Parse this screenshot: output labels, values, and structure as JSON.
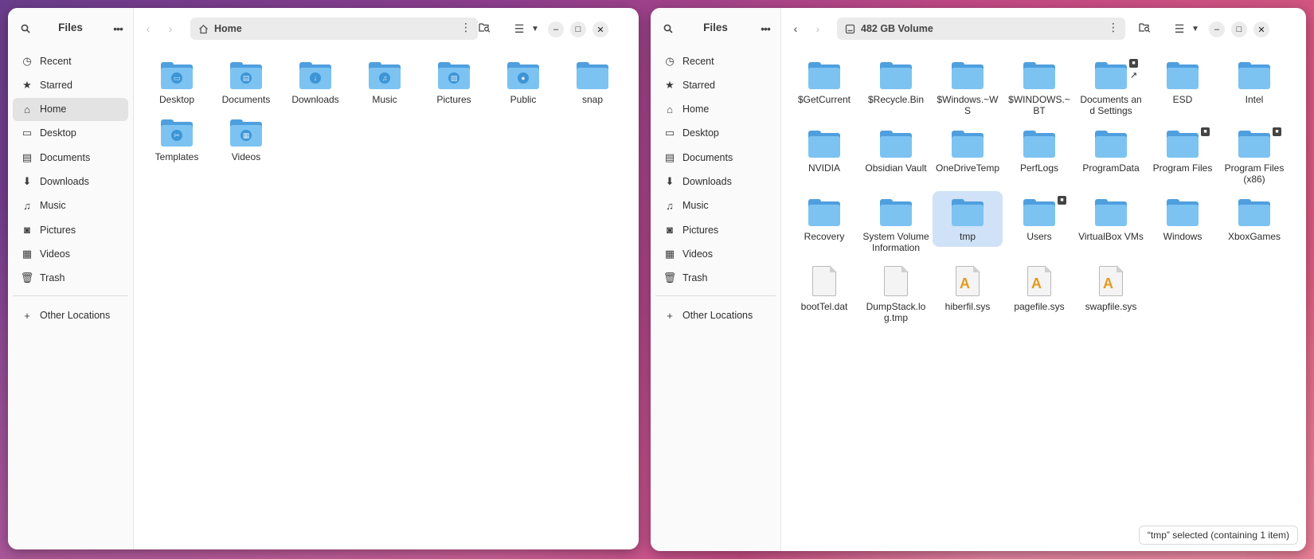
{
  "left_window": {
    "sidebar": {
      "title": "Files",
      "items": [
        {
          "label": "Recent",
          "icon": "clock-icon",
          "active": false
        },
        {
          "label": "Starred",
          "icon": "star-icon",
          "active": false
        },
        {
          "label": "Home",
          "icon": "home-icon",
          "active": true
        },
        {
          "label": "Desktop",
          "icon": "desktop-icon",
          "active": false
        },
        {
          "label": "Documents",
          "icon": "document-icon",
          "active": false
        },
        {
          "label": "Downloads",
          "icon": "download-icon",
          "active": false
        },
        {
          "label": "Music",
          "icon": "music-icon",
          "active": false
        },
        {
          "label": "Pictures",
          "icon": "camera-icon",
          "active": false
        },
        {
          "label": "Videos",
          "icon": "film-icon",
          "active": false
        },
        {
          "label": "Trash",
          "icon": "trash-icon",
          "active": false
        }
      ],
      "other_locations": "Other Locations"
    },
    "path": "Home",
    "items": [
      {
        "label": "Desktop",
        "kind": "folder",
        "emblem": "desktop"
      },
      {
        "label": "Documents",
        "kind": "folder",
        "emblem": "document"
      },
      {
        "label": "Downloads",
        "kind": "folder",
        "emblem": "download"
      },
      {
        "label": "Music",
        "kind": "folder",
        "emblem": "music"
      },
      {
        "label": "Pictures",
        "kind": "folder",
        "emblem": "picture"
      },
      {
        "label": "Public",
        "kind": "folder",
        "emblem": "user"
      },
      {
        "label": "snap",
        "kind": "folder",
        "emblem": ""
      },
      {
        "label": "Templates",
        "kind": "folder",
        "emblem": "template"
      },
      {
        "label": "Videos",
        "kind": "folder",
        "emblem": "video"
      }
    ]
  },
  "right_window": {
    "sidebar": {
      "title": "Files",
      "items": [
        {
          "label": "Recent",
          "icon": "clock-icon",
          "active": false
        },
        {
          "label": "Starred",
          "icon": "star-icon",
          "active": false
        },
        {
          "label": "Home",
          "icon": "home-icon",
          "active": false
        },
        {
          "label": "Desktop",
          "icon": "desktop-icon",
          "active": false
        },
        {
          "label": "Documents",
          "icon": "document-icon",
          "active": false
        },
        {
          "label": "Downloads",
          "icon": "download-icon",
          "active": false
        },
        {
          "label": "Music",
          "icon": "music-icon",
          "active": false
        },
        {
          "label": "Pictures",
          "icon": "camera-icon",
          "active": false
        },
        {
          "label": "Videos",
          "icon": "film-icon",
          "active": false
        },
        {
          "label": "Trash",
          "icon": "trash-icon",
          "active": false
        }
      ],
      "other_locations": "Other Locations"
    },
    "path": "482 GB Volume",
    "items": [
      {
        "label": "$GetCurrent",
        "kind": "folder"
      },
      {
        "label": "$Recycle.Bin",
        "kind": "folder"
      },
      {
        "label": "$Windows.~WS",
        "kind": "folder"
      },
      {
        "label": "$WINDOWS.~BT",
        "kind": "folder"
      },
      {
        "label": "Documents and Settings",
        "kind": "folder",
        "lock": true,
        "link": true
      },
      {
        "label": "ESD",
        "kind": "folder"
      },
      {
        "label": "Intel",
        "kind": "folder"
      },
      {
        "label": "NVIDIA",
        "kind": "folder"
      },
      {
        "label": "Obsidian Vault",
        "kind": "folder"
      },
      {
        "label": "OneDriveTemp",
        "kind": "folder"
      },
      {
        "label": "PerfLogs",
        "kind": "folder"
      },
      {
        "label": "ProgramData",
        "kind": "folder"
      },
      {
        "label": "Program Files",
        "kind": "folder",
        "lock": true
      },
      {
        "label": "Program Files (x86)",
        "kind": "folder",
        "lock": true
      },
      {
        "label": "Recovery",
        "kind": "folder"
      },
      {
        "label": "System Volume Information",
        "kind": "folder"
      },
      {
        "label": "tmp",
        "kind": "folder",
        "selected": true
      },
      {
        "label": "Users",
        "kind": "folder",
        "lock": true
      },
      {
        "label": "VirtualBox VMs",
        "kind": "folder"
      },
      {
        "label": "Windows",
        "kind": "folder"
      },
      {
        "label": "XboxGames",
        "kind": "folder"
      },
      {
        "label": "bootTel.dat",
        "kind": "file"
      },
      {
        "label": "DumpStack.log.tmp",
        "kind": "file"
      },
      {
        "label": "hiberfil.sys",
        "kind": "binary"
      },
      {
        "label": "pagefile.sys",
        "kind": "binary"
      },
      {
        "label": "swapfile.sys",
        "kind": "binary"
      }
    ],
    "status": "“tmp” selected  (containing 1 item)"
  }
}
